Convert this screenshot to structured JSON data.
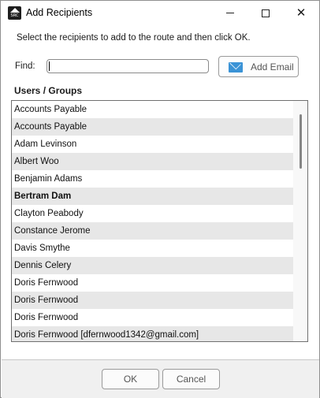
{
  "window": {
    "title": "Add Recipients",
    "icon": "app-logo-icon",
    "icon_text": "SRC",
    "controls": {
      "minimize": "minimize-icon",
      "maximize": "maximize-icon",
      "close": "close-icon",
      "close_glyph": "✕"
    }
  },
  "instruction": "Select the recipients to add to the route and then click OK.",
  "find": {
    "label": "Find:",
    "value": "",
    "placeholder": ""
  },
  "add_email_button": {
    "label": "Add Email",
    "icon": "mail-icon",
    "icon_color": "#3a93d6"
  },
  "users_groups": {
    "header": "Users / Groups",
    "items": [
      {
        "label": "Accounts Payable",
        "group": false
      },
      {
        "label": "Accounts Payable",
        "group": false
      },
      {
        "label": "Adam Levinson",
        "group": false
      },
      {
        "label": "Albert Woo",
        "group": false
      },
      {
        "label": "Benjamin Adams",
        "group": false
      },
      {
        "label": "Bertram Dam",
        "group": true
      },
      {
        "label": "Clayton Peabody",
        "group": false
      },
      {
        "label": "Constance Jerome",
        "group": false
      },
      {
        "label": "Davis Smythe",
        "group": false
      },
      {
        "label": "Dennis Celery",
        "group": false
      },
      {
        "label": "Doris Fernwood",
        "group": false
      },
      {
        "label": "Doris Fernwood",
        "group": false
      },
      {
        "label": "Doris Fernwood",
        "group": false
      },
      {
        "label": "Doris Fernwood [dfernwood1342@gmail.com]",
        "group": false
      }
    ]
  },
  "buttons": {
    "ok": "OK",
    "cancel": "Cancel"
  }
}
